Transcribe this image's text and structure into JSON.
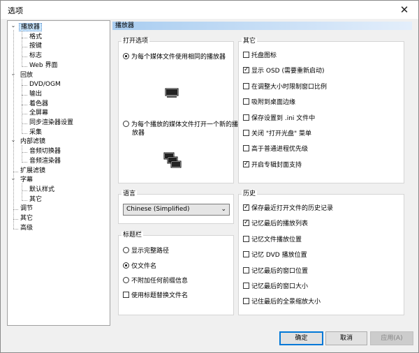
{
  "window": {
    "title": "选项",
    "close_glyph": "✕"
  },
  "tree": [
    {
      "label": "播放器",
      "level": 0,
      "expanded": true,
      "selected": true
    },
    {
      "label": "格式",
      "level": 1
    },
    {
      "label": "按键",
      "level": 1
    },
    {
      "label": "标志",
      "level": 1
    },
    {
      "label": "Web 界面",
      "level": 1
    },
    {
      "label": "回放",
      "level": 0,
      "expanded": true
    },
    {
      "label": "DVD/OGM",
      "level": 1
    },
    {
      "label": "输出",
      "level": 1
    },
    {
      "label": "着色器",
      "level": 1
    },
    {
      "label": "全屏幕",
      "level": 1
    },
    {
      "label": "同步渲染器设置",
      "level": 1
    },
    {
      "label": "采集",
      "level": 1
    },
    {
      "label": "内部滤镜",
      "level": 0,
      "expanded": true
    },
    {
      "label": "音频切换器",
      "level": 1
    },
    {
      "label": "音频渲染器",
      "level": 1
    },
    {
      "label": "扩展滤镜",
      "level": 0
    },
    {
      "label": "字幕",
      "level": 0,
      "expanded": true
    },
    {
      "label": "默认样式",
      "level": 1
    },
    {
      "label": "其它",
      "level": 1
    },
    {
      "label": "调节",
      "level": 0
    },
    {
      "label": "其它",
      "level": 0
    },
    {
      "label": "高级",
      "level": 0
    }
  ],
  "page": {
    "title": "播放器"
  },
  "open_options": {
    "title": "打开选项",
    "option1": "为每个媒体文件使用相同的播放器",
    "option2_line1": "为每个播放的媒体文件打开一个新的播放",
    "option2_line2": "放器",
    "selected": 1
  },
  "language": {
    "title": "语言",
    "value": "Chinese (Simplified)",
    "chevron": "⌄"
  },
  "titlebar_group": {
    "title": "标题栏",
    "options": [
      "显示完整路径",
      "仅文件名",
      "不附加任何前缀信息"
    ],
    "selected": 1,
    "checkbox": {
      "label": "使用标题替换文件名",
      "checked": false
    }
  },
  "other": {
    "title": "其它",
    "items": [
      {
        "label": "托盘图标",
        "checked": false
      },
      {
        "label": "显示 OSD (需要重新启动)",
        "checked": true
      },
      {
        "label": "在调整大小时限制窗口比例",
        "checked": false
      },
      {
        "label": "吸附到桌面边缘",
        "checked": false
      },
      {
        "label": "保存设置到 .ini 文件中",
        "checked": false
      },
      {
        "label": "关闭 \"打开光盘\" 菜单",
        "checked": false
      },
      {
        "label": "高于普通进程优先级",
        "checked": false
      },
      {
        "label": "开启专辑封面支持",
        "checked": true
      }
    ]
  },
  "history": {
    "title": "历史",
    "items": [
      {
        "label": "保存最近打开文件的历史记录",
        "checked": true
      },
      {
        "label": "记忆最后的播放列表",
        "checked": true
      },
      {
        "label": "记忆文件播放位置",
        "checked": false
      },
      {
        "label": "记忆 DVD 播放位置",
        "checked": false
      },
      {
        "label": "记忆最后的窗口位置",
        "checked": false
      },
      {
        "label": "记忆最后的窗口大小",
        "checked": false
      },
      {
        "label": "记住最后的全景缩放大小",
        "checked": false
      }
    ]
  },
  "buttons": {
    "ok": "确定",
    "cancel": "取消",
    "apply": "应用(A)"
  }
}
